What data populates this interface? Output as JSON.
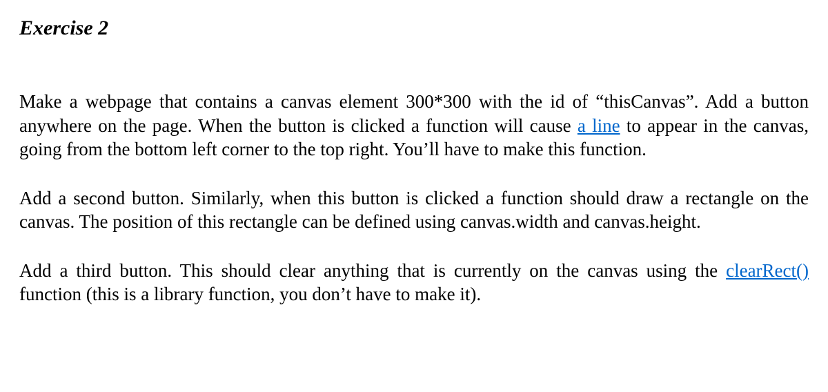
{
  "heading": "Exercise 2",
  "para1": {
    "t1": "Make a webpage that contains a canvas element 300*300  with the id of “thisCanvas”. Add a button anywhere on the page. When the button is clicked a function will cause ",
    "link": "a line",
    "t2": " to appear in the canvas, going from the bottom left corner to the top right. You’ll have to make this function."
  },
  "para2": "Add a second button. Similarly, when this button is clicked a function should draw a rectangle on the canvas. The position of this rectangle can be defined using canvas.width and canvas.height.",
  "para3": {
    "t1": "Add a third button. This should clear anything that is currently on the canvas using the ",
    "link": "clearRect()",
    "t2": " function (this is a library function, you don’t have to make it)."
  },
  "cutoff": ""
}
